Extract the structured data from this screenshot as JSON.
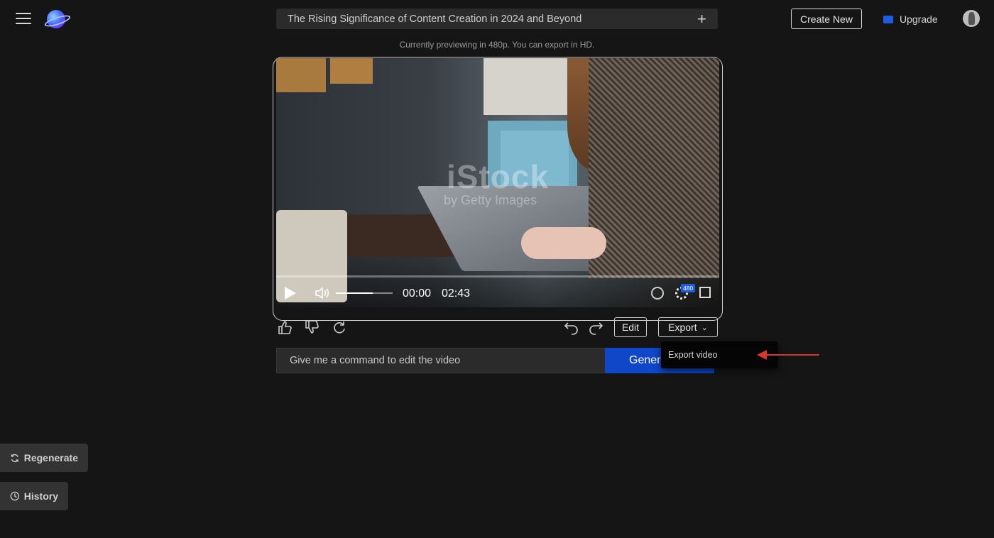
{
  "header": {
    "project_title": "The Rising Significance of Content Creation in 2024 and Beyond",
    "create_new_label": "Create New",
    "upgrade_label": "Upgrade",
    "preview_note": "Currently previewing in 480p. You can export in HD."
  },
  "video": {
    "watermark_main": "iStock",
    "watermark_sub": "by Getty Images",
    "current_time": "00:00",
    "duration": "02:43",
    "quality_badge": "480",
    "volume_level": 0.65
  },
  "actions": {
    "edit_label": "Edit",
    "export_label": "Export",
    "export_menu_item": "Export video"
  },
  "command": {
    "placeholder": "Give me a command to edit the video",
    "generate_label": "Generate"
  },
  "sidebar": {
    "regenerate_label": "Regenerate",
    "history_label": "History"
  },
  "colors": {
    "background": "#151515",
    "accent_blue": "#1047c9",
    "annotation_red": "#d9372a"
  }
}
